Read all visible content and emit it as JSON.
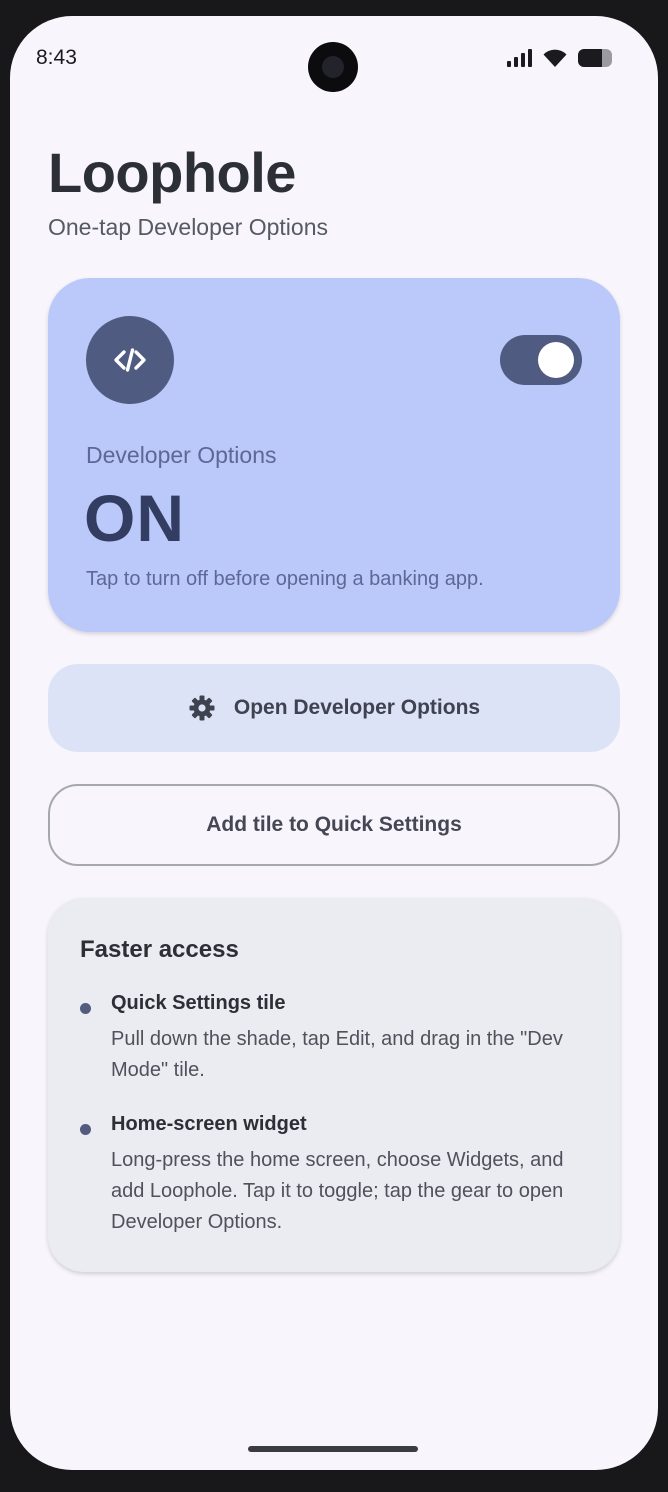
{
  "status_bar": {
    "time": "8:43"
  },
  "header": {
    "title": "Loophole",
    "subtitle": "One-tap Developer Options"
  },
  "status_card": {
    "icon": "code-icon",
    "label": "Developer Options",
    "state": "ON",
    "hint": "Tap to turn off before opening a banking app.",
    "toggle_on": true
  },
  "actions": {
    "open_dev_options_label": "Open Developer Options",
    "open_dev_options_icon": "gear-icon",
    "add_tile_label": "Add tile to Quick Settings"
  },
  "faster_access": {
    "title": "Faster access",
    "items": [
      {
        "title": "Quick Settings tile",
        "description": "Pull down the shade, tap Edit, and drag in the \"Dev Mode\" tile."
      },
      {
        "title": "Home-screen widget",
        "description": "Long-press the home screen, choose Widgets, and add Loophole. Tap it to toggle; tap the gear to open Developer Options."
      }
    ]
  },
  "colors": {
    "background": "#f8f5fc",
    "status_card": "#bac8fa",
    "accent_dark": "#4f5b80",
    "secondary_button": "#dde3f6",
    "info_card": "#ebebf2"
  }
}
